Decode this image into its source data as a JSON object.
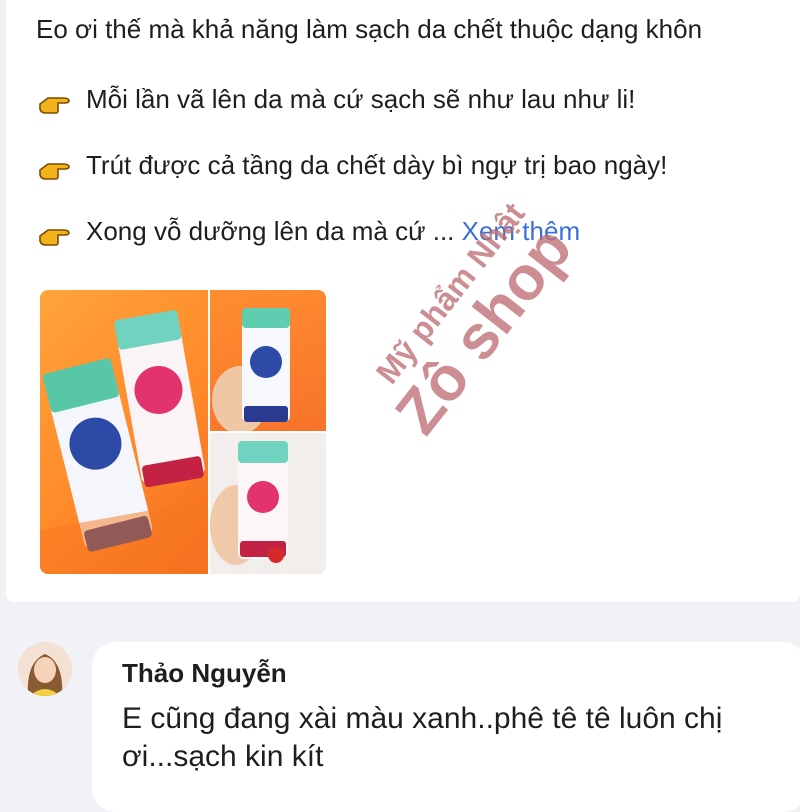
{
  "post": {
    "line0": "Eo ơi thế mà khả năng làm sạch da chết thuộc dạng khôn",
    "bullets": [
      {
        "icon": "pointing-hand-icon",
        "text": "Mỗi lần vã lên da mà cứ sạch sẽ như lau như li!"
      },
      {
        "icon": "pointing-hand-icon",
        "text": "Trút được cả tầng da chết dày bì ngự trị bao ngày!"
      },
      {
        "icon": "pointing-hand-icon",
        "text": "Xong vỗ dưỡng lên da mà cứ ... "
      }
    ],
    "see_more": "Xem thêm",
    "watermark_line1": "Mỹ phẩm Nhật",
    "watermark_line2": "Zô shop"
  },
  "comment": {
    "author": "Thảo Nguyễn",
    "text": "E cũng đang xài màu xanh..phê tê tê luôn chị ơi...sạch kin kít"
  },
  "colors": {
    "link": "#3a6fd8",
    "page_bg": "#f0f2f5",
    "accent_orange": "#ff8a2a"
  }
}
